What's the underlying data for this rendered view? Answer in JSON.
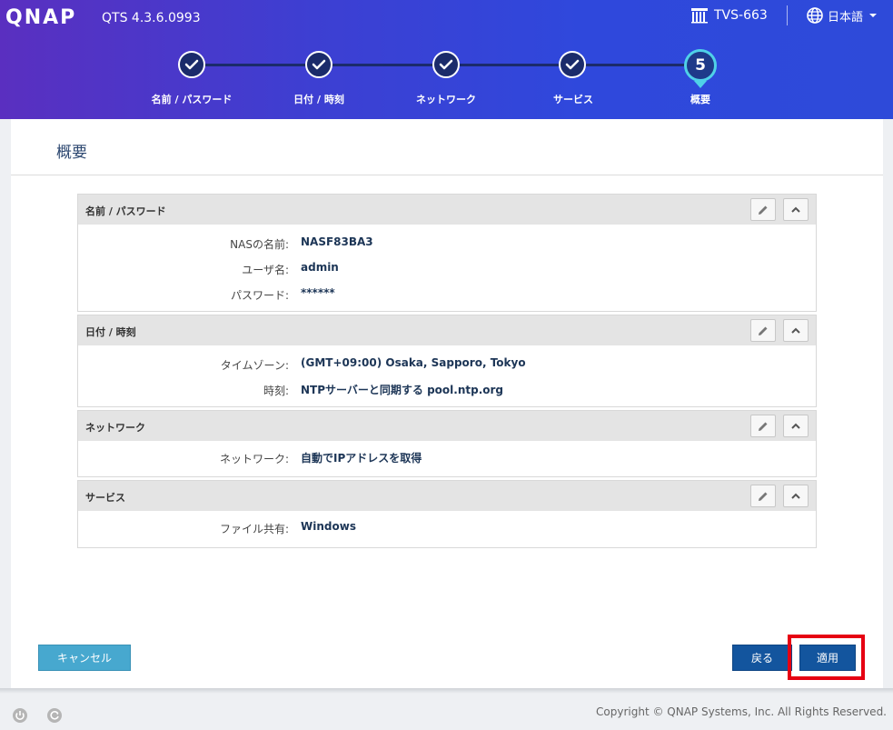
{
  "header": {
    "logo": "QNAP",
    "version": "QTS 4.3.6.0993",
    "model": "TVS-663",
    "language": "日本語"
  },
  "steps": [
    {
      "label": "名前 / パスワード",
      "status": "done"
    },
    {
      "label": "日付 / 時刻",
      "status": "done"
    },
    {
      "label": "ネットワーク",
      "status": "done"
    },
    {
      "label": "サービス",
      "status": "done"
    },
    {
      "label": "概要",
      "status": "current",
      "number": "5"
    }
  ],
  "panel": {
    "title": "概要"
  },
  "sections": [
    {
      "title": "名前 / パスワード",
      "rows": [
        {
          "label": "NASの名前:",
          "value": "NASF83BA3"
        },
        {
          "label": "ユーザ名:",
          "value": "admin"
        },
        {
          "label": "パスワード:",
          "value": "******"
        }
      ]
    },
    {
      "title": "日付 / 時刻",
      "rows": [
        {
          "label": "タイムゾーン:",
          "value": "(GMT+09:00) Osaka, Sapporo, Tokyo"
        },
        {
          "label": "時刻:",
          "value": "NTPサーバーと同期する pool.ntp.org"
        }
      ]
    },
    {
      "title": "ネットワーク",
      "rows": [
        {
          "label": "ネットワーク:",
          "value": "自動でIPアドレスを取得"
        }
      ]
    },
    {
      "title": "サービス",
      "rows": [
        {
          "label": "ファイル共有:",
          "value": "Windows"
        }
      ]
    }
  ],
  "buttons": {
    "cancel": "キャンセル",
    "back": "戻る",
    "apply": "適用"
  },
  "footer": {
    "copyright": "Copyright © QNAP Systems, Inc. All Rights Reserved."
  },
  "colors": {
    "header_gradient_start": "#5a2fc0",
    "header_gradient_end": "#2e4ad9",
    "step_done": "#1b2b6b",
    "step_current_ring": "#4fd1e8",
    "value_text": "#1c3556",
    "primary_button": "#13559e",
    "cancel_button": "#47a8cf",
    "highlight": "#e60012"
  }
}
